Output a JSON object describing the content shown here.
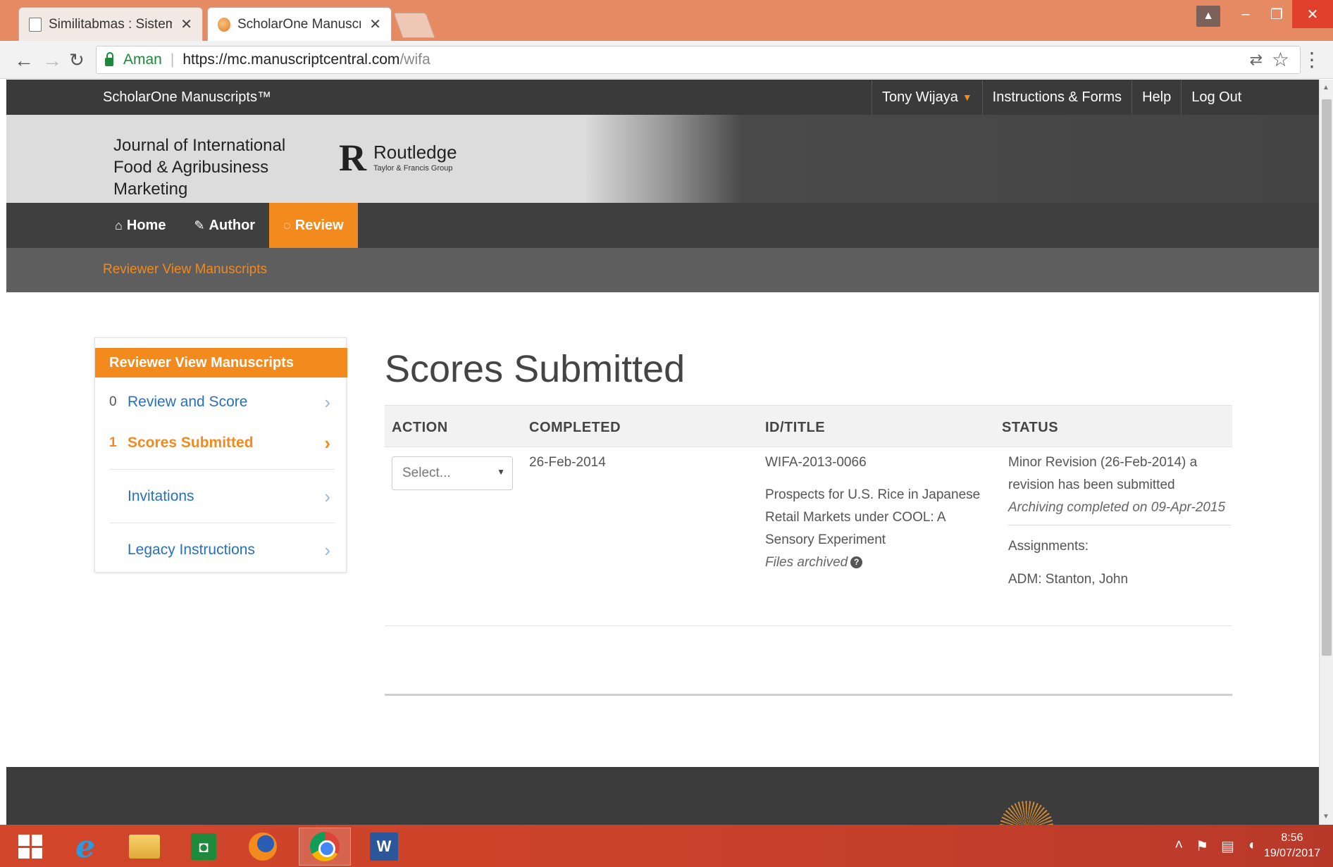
{
  "browser": {
    "tabs": [
      {
        "label": "Similitabmas : Sistem Inf",
        "icon": "document-icon",
        "active": false
      },
      {
        "label": "ScholarOne Manuscripts",
        "icon": "scholarone-icon",
        "active": true
      }
    ],
    "address": {
      "secure_label": "Aman",
      "url_host": "https://mc.manuscriptcentral.com",
      "url_path": "/wifa"
    }
  },
  "topnav": {
    "brand": "ScholarOne Manuscripts™",
    "user": "Tony Wijaya",
    "instructions": "Instructions & Forms",
    "help": "Help",
    "logout": "Log Out"
  },
  "banner": {
    "journal_line1": "Journal of International",
    "journal_line2": "Food & Agribusiness Marketing",
    "publisher_mark": "R",
    "publisher": "Routledge",
    "publisher_sub": "Taylor & Francis Group"
  },
  "mainnav": {
    "home": "Home",
    "author": "Author",
    "review": "Review"
  },
  "subnav": {
    "link": "Reviewer View Manuscripts"
  },
  "sidebar": {
    "header": "Reviewer View Manuscripts",
    "items": [
      {
        "count": "0",
        "label": "Review and Score"
      },
      {
        "count": "1",
        "label": "Scores Submitted"
      },
      {
        "count": "",
        "label": "Invitations"
      },
      {
        "count": "",
        "label": "Legacy Instructions"
      }
    ]
  },
  "main": {
    "title": "Scores Submitted",
    "columns": [
      "ACTION",
      "COMPLETED",
      "ID/TITLE",
      "STATUS"
    ],
    "row": {
      "action_placeholder": "Select...",
      "completed": "26-Feb-2014",
      "id": "WIFA-2013-0066",
      "title_line1": "Prospects for U.S. Rice in Japanese",
      "title_line2": "Retail Markets under COOL: A",
      "title_line3": "Sensory Experiment",
      "files": "Files archived",
      "status_line1": "Minor Revision (26-Feb-2014) a",
      "status_line2": "revision has been submitted",
      "archiving": "Archiving completed on 09-Apr-2015",
      "assignments_label": "Assignments:",
      "assignment": "ADM: Stanton, John"
    }
  },
  "taskbar": {
    "time": "8:56",
    "date": "19/07/2017"
  },
  "colors": {
    "accent": "#f28a1e",
    "link": "#2a70b8",
    "topnav": "#3a3a3a",
    "tabbar": "#e58a63",
    "taskbar": "#c8402a"
  }
}
